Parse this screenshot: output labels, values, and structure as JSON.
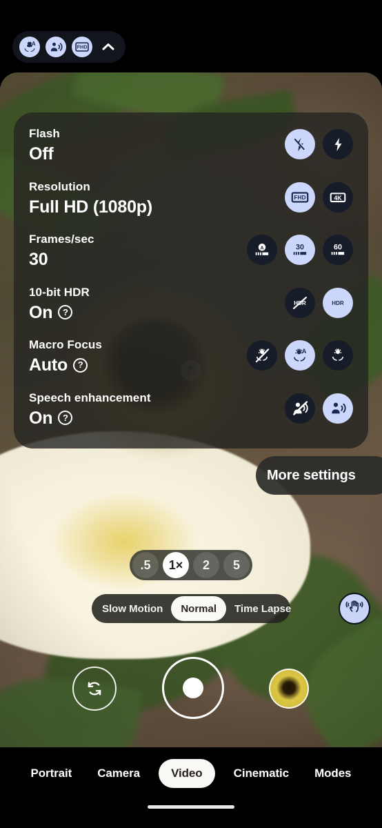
{
  "status_pill": {
    "icons": [
      {
        "name": "macro-auto-icon",
        "label": "Macro focus auto"
      },
      {
        "name": "speech-enhancement-icon",
        "label": "Speech enhancement on"
      },
      {
        "name": "fhd-icon",
        "label": "FHD"
      }
    ],
    "collapse_label": "Collapse settings"
  },
  "settings_panel": {
    "rows": [
      {
        "label": "Flash",
        "value": "Off",
        "has_help": false,
        "options": [
          {
            "icon": "flash-off-icon",
            "selected": true
          },
          {
            "icon": "flash-on-icon",
            "selected": false
          }
        ]
      },
      {
        "label": "Resolution",
        "value": "Full HD (1080p)",
        "has_help": false,
        "options": [
          {
            "icon": "fhd-icon",
            "selected": true,
            "text": "FHD"
          },
          {
            "icon": "4k-icon",
            "selected": false,
            "text": "4K"
          }
        ]
      },
      {
        "label": "Frames/sec",
        "value": "30",
        "has_help": false,
        "options": [
          {
            "icon": "fps-auto-icon",
            "selected": false,
            "text": "A"
          },
          {
            "icon": "fps-30-icon",
            "selected": true,
            "text": "30"
          },
          {
            "icon": "fps-60-icon",
            "selected": false,
            "text": "60"
          }
        ]
      },
      {
        "label": "10-bit HDR",
        "value": "On",
        "has_help": true,
        "options": [
          {
            "icon": "hdr-off-icon",
            "selected": false,
            "text": "HDR"
          },
          {
            "icon": "hdr-on-icon",
            "selected": true,
            "text": "HDR"
          }
        ]
      },
      {
        "label": "Macro Focus",
        "value": "Auto",
        "has_help": true,
        "options": [
          {
            "icon": "macro-off-icon",
            "selected": false
          },
          {
            "icon": "macro-auto-icon",
            "selected": true
          },
          {
            "icon": "macro-on-icon",
            "selected": false
          }
        ]
      },
      {
        "label": "Speech enhancement",
        "value": "On",
        "has_help": true,
        "options": [
          {
            "icon": "speech-off-icon",
            "selected": false
          },
          {
            "icon": "speech-on-icon",
            "selected": true
          }
        ]
      }
    ],
    "help_glyph": "?"
  },
  "more_settings": {
    "label": "More settings"
  },
  "zoom": {
    "options": [
      {
        "label": ".5",
        "selected": false
      },
      {
        "label": "1×",
        "selected": true
      },
      {
        "label": "2",
        "selected": false
      },
      {
        "label": "5",
        "selected": false
      }
    ]
  },
  "video_modes": {
    "options": [
      {
        "label": "Slow Motion",
        "selected": false
      },
      {
        "label": "Normal",
        "selected": true
      },
      {
        "label": "Time Lapse",
        "selected": false
      }
    ]
  },
  "stabilization": {
    "name": "stabilization-icon",
    "label": "Stabilization"
  },
  "shutter_row": {
    "flip_label": "Switch camera",
    "shutter_label": "Record",
    "gallery_label": "Gallery"
  },
  "bottom_tabs": {
    "tabs": [
      {
        "label": "Portrait",
        "selected": false
      },
      {
        "label": "Camera",
        "selected": false
      },
      {
        "label": "Video",
        "selected": true
      },
      {
        "label": "Cinematic",
        "selected": false
      },
      {
        "label": "Modes",
        "selected": false
      }
    ]
  },
  "preview": {
    "macro_badge": "macro-active-icon"
  },
  "colors": {
    "accent_selected": "#ccd7fb",
    "icon_dark": "#1b2a52",
    "chip_dark": "#171c29",
    "panel_bg": "rgba(36,36,34,0.80)",
    "white": "#ffffff"
  }
}
